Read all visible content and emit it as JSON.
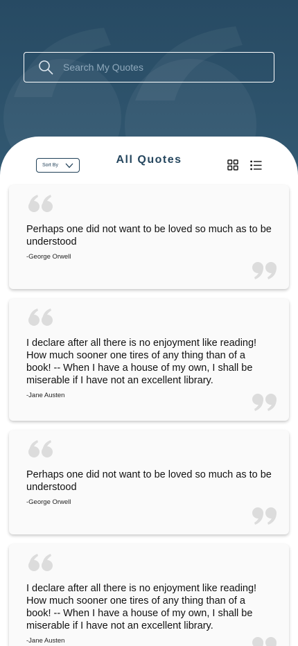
{
  "search": {
    "placeholder": "Search My Quotes"
  },
  "toolbar": {
    "sort_label": "Sort By",
    "title": "All Quotes"
  },
  "icons": {
    "search": "search-icon",
    "sort_dropdown": "chevron-down-icon",
    "grid_view": "grid-view-icon",
    "list_view": "list-view-icon",
    "quote_open": "quote-open-icon",
    "quote_close": "quote-close-icon"
  },
  "colors": {
    "header_bg": "#2f5470",
    "accent": "#25465e",
    "card_bg": "#fafafa",
    "quote_mark": "#dcdcdc"
  },
  "quotes": [
    {
      "text": "Perhaps one did not want to be loved so much as to be understood",
      "author": "-George Orwell"
    },
    {
      "text": "I declare after all there is no enjoyment like reading! How much sooner one tires of any thing than of a book! -- When I have a house of my own, I shall be miserable if I have not an excellent library.",
      "author": "-Jane Austen"
    },
    {
      "text": "Perhaps one did not want to be loved so much as to be understood",
      "author": "-George Orwell"
    },
    {
      "text": "I declare after all there is no enjoyment like reading! How much sooner one tires of any thing than of a book! -- When I have a house of my own, I shall be miserable if I have not an excellent library.",
      "author": "-Jane Austen"
    }
  ]
}
